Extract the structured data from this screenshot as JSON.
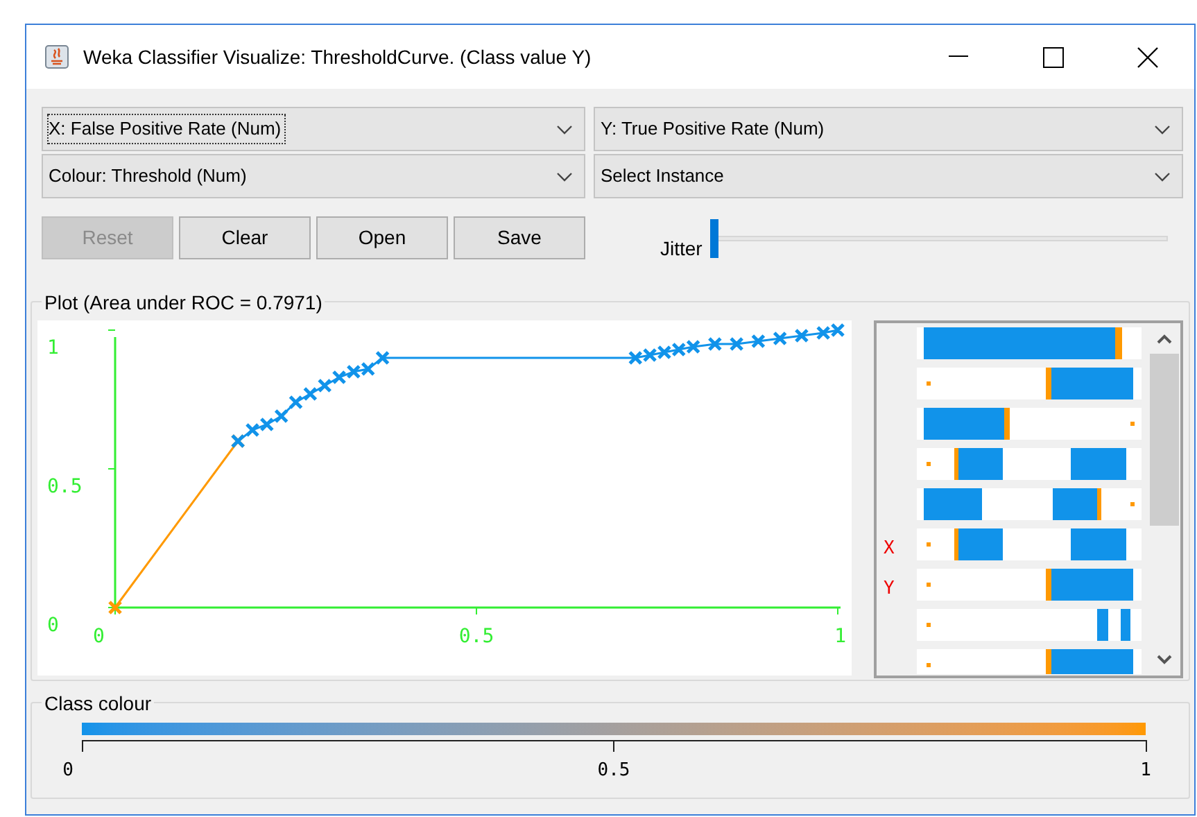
{
  "window": {
    "title": "Weka Classifier Visualize: ThresholdCurve. (Class value Y)"
  },
  "selectors": [
    {
      "label": "X: False Positive Rate (Num)",
      "focused": true
    },
    {
      "label": "Y: True Positive Rate (Num)",
      "focused": false
    },
    {
      "label": "Colour: Threshold (Num)",
      "focused": false
    },
    {
      "label": "Select Instance",
      "focused": false
    }
  ],
  "buttons": [
    {
      "label": "Reset",
      "disabled": true
    },
    {
      "label": "Clear",
      "disabled": false
    },
    {
      "label": "Open",
      "disabled": false
    },
    {
      "label": "Save",
      "disabled": false
    }
  ],
  "jitter": {
    "label": "Jitter",
    "level": 0
  },
  "plot": {
    "title": "Plot (Area under ROC = 0.7971)",
    "chart_data": {
      "type": "line",
      "x": [
        0,
        0.17,
        0.19,
        0.21,
        0.23,
        0.25,
        0.27,
        0.29,
        0.31,
        0.33,
        0.35,
        0.37,
        0.72,
        0.74,
        0.76,
        0.78,
        0.8,
        0.83,
        0.86,
        0.89,
        0.92,
        0.95,
        0.98,
        1
      ],
      "series": [
        {
          "color": "#ff9900",
          "marker": "x",
          "values": [
            0,
            0.6,
            null,
            null,
            null,
            null,
            null,
            null,
            null,
            null,
            null,
            null,
            null,
            null,
            null,
            null,
            null,
            null,
            null,
            null,
            null,
            null,
            null,
            null
          ]
        },
        {
          "color": "#1193ea",
          "marker": "x",
          "values": [
            null,
            0.6,
            0.64,
            0.66,
            0.69,
            0.74,
            0.77,
            0.8,
            0.83,
            0.85,
            0.86,
            0.9,
            0.9,
            0.91,
            0.92,
            0.93,
            0.94,
            0.95,
            0.95,
            0.96,
            0.97,
            0.98,
            0.99,
            1
          ]
        }
      ],
      "xlim": [
        0,
        1
      ],
      "ylim": [
        0,
        1
      ],
      "xticks": [
        0,
        0.5,
        1
      ],
      "yticks": [
        0,
        0.5,
        1
      ]
    }
  },
  "attribute_panel": {
    "axis_markers": [
      "X",
      "Y"
    ]
  },
  "class_colour": {
    "title": "Class colour",
    "ticks": [
      "0",
      "0.5",
      "1"
    ]
  }
}
